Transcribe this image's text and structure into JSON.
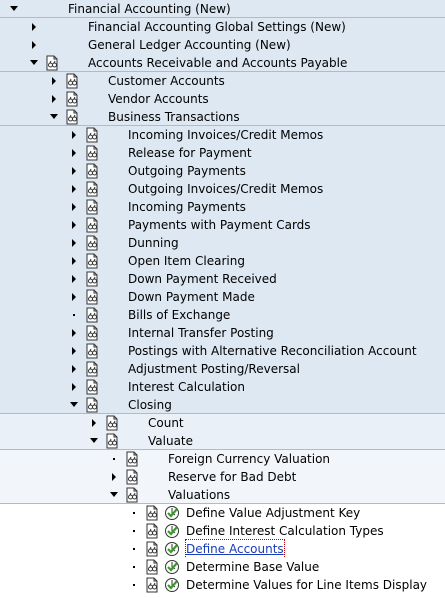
{
  "tree": {
    "rows": [
      {
        "label": "",
        "depth": 1,
        "type": "doc",
        "shade": "c1",
        "sep": false
      },
      {
        "label": "Financial Accounting (New)",
        "depth": 1,
        "type": "expanded",
        "shade": "c1",
        "sep": true
      },
      {
        "label": "Financial Accounting Global Settings (New)",
        "depth": 2,
        "type": "collapsed",
        "shade": "c1",
        "sep": false
      },
      {
        "label": "General Ledger Accounting (New)",
        "depth": 2,
        "type": "collapsed",
        "shade": "c1",
        "sep": false
      },
      {
        "label": "Accounts Receivable and Accounts Payable",
        "depth": 2,
        "type": "expanded",
        "icon": "doc",
        "shade": "c1",
        "sep": true
      },
      {
        "label": "Customer Accounts",
        "depth": 3,
        "type": "collapsed",
        "icon": "doc",
        "shade": "c1",
        "sep": false
      },
      {
        "label": "Vendor Accounts",
        "depth": 3,
        "type": "collapsed",
        "icon": "doc",
        "shade": "c1",
        "sep": false
      },
      {
        "label": "Business Transactions",
        "depth": 3,
        "type": "expanded",
        "icon": "doc",
        "shade": "c1",
        "sep": true
      },
      {
        "label": "Incoming Invoices/Credit Memos",
        "depth": 4,
        "type": "collapsed",
        "icon": "doc",
        "shade": "c1",
        "sep": false
      },
      {
        "label": "Release for Payment",
        "depth": 4,
        "type": "collapsed",
        "icon": "doc",
        "shade": "c1",
        "sep": false
      },
      {
        "label": "Outgoing Payments",
        "depth": 4,
        "type": "collapsed",
        "icon": "doc",
        "shade": "c1",
        "sep": false
      },
      {
        "label": "Outgoing Invoices/Credit Memos",
        "depth": 4,
        "type": "collapsed",
        "icon": "doc",
        "shade": "c1",
        "sep": false
      },
      {
        "label": "Incoming Payments",
        "depth": 4,
        "type": "collapsed",
        "icon": "doc",
        "shade": "c1",
        "sep": false
      },
      {
        "label": "Payments with Payment Cards",
        "depth": 4,
        "type": "collapsed",
        "icon": "doc",
        "shade": "c1",
        "sep": false
      },
      {
        "label": "Dunning",
        "depth": 4,
        "type": "collapsed",
        "icon": "doc",
        "shade": "c1",
        "sep": false
      },
      {
        "label": "Open Item Clearing",
        "depth": 4,
        "type": "collapsed",
        "icon": "doc",
        "shade": "c1",
        "sep": false
      },
      {
        "label": "Down Payment Received",
        "depth": 4,
        "type": "collapsed",
        "icon": "doc",
        "shade": "c1",
        "sep": false
      },
      {
        "label": "Down Payment Made",
        "depth": 4,
        "type": "collapsed",
        "icon": "doc",
        "shade": "c1",
        "sep": false
      },
      {
        "label": "Bills of Exchange",
        "depth": 4,
        "type": "leaf",
        "icon": "doc",
        "shade": "c1",
        "sep": false
      },
      {
        "label": "Internal Transfer Posting",
        "depth": 4,
        "type": "collapsed",
        "icon": "doc",
        "shade": "c1",
        "sep": false
      },
      {
        "label": "Postings with Alternative Reconciliation Account",
        "depth": 4,
        "type": "collapsed",
        "icon": "doc",
        "shade": "c1",
        "sep": false
      },
      {
        "label": "Adjustment Posting/Reversal",
        "depth": 4,
        "type": "collapsed",
        "icon": "doc",
        "shade": "c1",
        "sep": false
      },
      {
        "label": "Interest Calculation",
        "depth": 4,
        "type": "collapsed",
        "icon": "doc",
        "shade": "c1",
        "sep": false
      },
      {
        "label": "Closing",
        "depth": 4,
        "type": "expanded",
        "icon": "doc",
        "shade": "c1",
        "sep": true
      },
      {
        "label": "Count",
        "depth": 5,
        "type": "collapsed",
        "icon": "doc",
        "shade": "c2",
        "sep": false
      },
      {
        "label": "Valuate",
        "depth": 5,
        "type": "expanded",
        "icon": "doc",
        "shade": "c2",
        "sep": true
      },
      {
        "label": "Foreign Currency Valuation",
        "depth": 6,
        "type": "leaf",
        "icon": "doc",
        "shade": "c3",
        "sep": false
      },
      {
        "label": "Reserve for Bad Debt",
        "depth": 6,
        "type": "collapsed",
        "icon": "doc",
        "shade": "c3",
        "sep": false
      },
      {
        "label": "Valuations",
        "depth": 6,
        "type": "expanded",
        "icon": "doc",
        "shade": "c3",
        "sep": true
      },
      {
        "label": "Define Value Adjustment Key",
        "depth": 7,
        "type": "leaf",
        "icon": "doc+exe",
        "shade": "c4",
        "sep": false
      },
      {
        "label": "Define Interest Calculation Types",
        "depth": 7,
        "type": "leaf",
        "icon": "doc+exe",
        "shade": "c4",
        "sep": false
      },
      {
        "label": "Define Accounts",
        "depth": 7,
        "type": "leaf",
        "icon": "doc+exe",
        "shade": "c4",
        "sep": false,
        "focus": true
      },
      {
        "label": "Determine Base Value",
        "depth": 7,
        "type": "leaf",
        "icon": "doc+exe",
        "shade": "c4",
        "sep": false
      },
      {
        "label": "Determine Values for Line Items Display",
        "depth": 7,
        "type": "leaf",
        "icon": "doc+exe",
        "shade": "c4",
        "sep": false
      }
    ]
  },
  "icons": {
    "expanded": "triangle-down-icon",
    "collapsed": "triangle-right-icon",
    "leaf": "bullet-icon",
    "doc": "documentation-icon",
    "exe": "execute-activity-icon"
  },
  "colors": {
    "band1": "#dde8f3",
    "band2": "#e9f0f8",
    "band3": "#f2f6fb",
    "separator": "#a9bdd2",
    "focus": "#b00000",
    "exe_green": "#3a9a2a"
  }
}
